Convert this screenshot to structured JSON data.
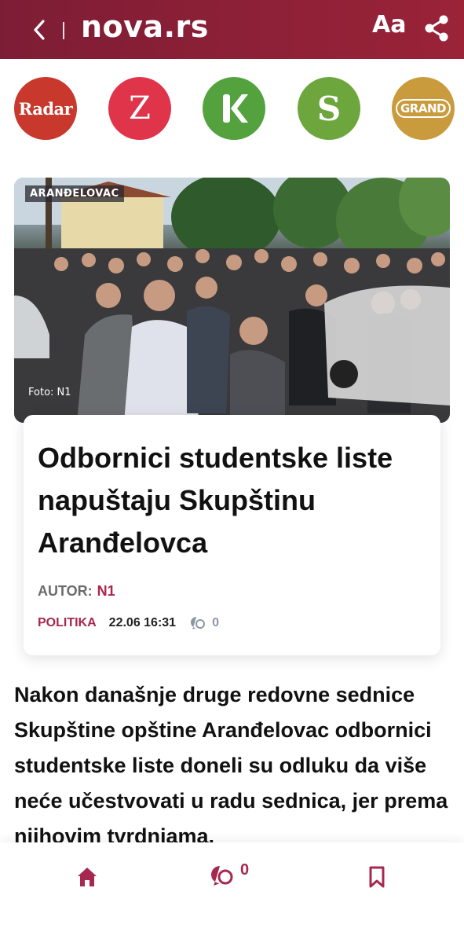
{
  "header": {
    "logo": "nova.rs",
    "font_size_button": "Aa",
    "back_icon": "chevron-left-icon",
    "share_icon": "share-icon",
    "bg_color": "#8e2037"
  },
  "channels": [
    {
      "label": "Radar",
      "color": "#c8382c"
    },
    {
      "label": "Z",
      "color": "#e0344b"
    },
    {
      "label": "K",
      "color": "#53a23e"
    },
    {
      "label": "S",
      "color": "#6da63d"
    },
    {
      "label": "GRAND",
      "color": "#c99b3d"
    }
  ],
  "hero": {
    "location": "ARANĐELOVAC",
    "credit": "Foto: N1"
  },
  "article": {
    "title": "Odbornici studentske liste napuštaju Skupštinu Aranđelovca",
    "author_label": "AUTOR:",
    "author": "N1",
    "category": "POLITIKA",
    "date": "22.06 16:31",
    "comments": "0",
    "body": "Nakon današnje druge redovne sednice Skupštine opštine Aranđelovac odbornici studentske liste doneli su odluku da više neće učestvovati u radu sednica, jer prema njihovim tvrdnjama,"
  },
  "bottom_nav": {
    "home_icon": "home-icon",
    "comments_icon": "comments-icon",
    "comments_count": "0",
    "bookmark_icon": "bookmark-icon"
  },
  "accent_color": "#a6284e"
}
